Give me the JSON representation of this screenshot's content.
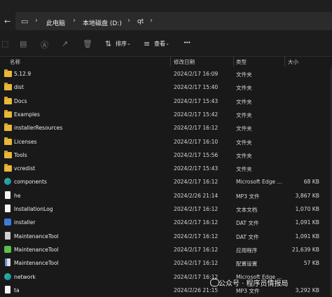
{
  "breadcrumbs": [
    "此电脑",
    "本地磁盘 (D:)",
    "qt"
  ],
  "toolbar": {
    "sort_label": "排序",
    "view_label": "查看",
    "more_label": "•••"
  },
  "columns": {
    "name": "名称",
    "modified": "修改日期",
    "type": "类型",
    "size": "大小"
  },
  "files": [
    {
      "name": "5.12.9",
      "date": "2024/2/17 16:09",
      "type": "文件夹",
      "size": "",
      "icon": "folder-icon"
    },
    {
      "name": "dist",
      "date": "2024/2/17 15:40",
      "type": "文件夹",
      "size": "",
      "icon": "folder-icon"
    },
    {
      "name": "Docs",
      "date": "2024/2/17 15:43",
      "type": "文件夹",
      "size": "",
      "icon": "folder-icon"
    },
    {
      "name": "Examples",
      "date": "2024/2/17 15:42",
      "type": "文件夹",
      "size": "",
      "icon": "folder-icon"
    },
    {
      "name": "installerResources",
      "date": "2024/2/17 16:12",
      "type": "文件夹",
      "size": "",
      "icon": "folder-icon"
    },
    {
      "name": "Licenses",
      "date": "2024/2/17 16:10",
      "type": "文件夹",
      "size": "",
      "icon": "folder-icon"
    },
    {
      "name": "Tools",
      "date": "2024/2/17 15:56",
      "type": "文件夹",
      "size": "",
      "icon": "folder-icon"
    },
    {
      "name": "vcredist",
      "date": "2024/2/17 15:43",
      "type": "文件夹",
      "size": "",
      "icon": "folder-icon"
    },
    {
      "name": "components",
      "date": "2024/2/17 16:12",
      "type": "Microsoft Edge ...",
      "size": "68 KB",
      "icon": "edge-icon"
    },
    {
      "name": "he",
      "date": "2024/2/26 21:14",
      "type": "MP3 文件",
      "size": "3,867 KB",
      "icon": "audio-file-icon"
    },
    {
      "name": "InstallationLog",
      "date": "2024/2/17 16:12",
      "type": "文本文档",
      "size": "1,070 KB",
      "icon": "text-file-icon"
    },
    {
      "name": "installer",
      "date": "2024/2/17 16:12",
      "type": "DAT 文件",
      "size": "1,091 KB",
      "icon": "dat-file-icon"
    },
    {
      "name": "MaintenanceTool",
      "date": "2024/2/17 16:12",
      "type": "DAT 文件",
      "size": "1,091 KB",
      "icon": "dat-file-icon"
    },
    {
      "name": "MaintenanceTool",
      "date": "2024/2/17 16:12",
      "type": "应用程序",
      "size": "21,639 KB",
      "icon": "application-icon"
    },
    {
      "name": "MaintenanceTool",
      "date": "2024/2/17 16:12",
      "type": "配置设置",
      "size": "57 KB",
      "icon": "config-file-icon"
    },
    {
      "name": "network",
      "date": "2024/2/17 16:12",
      "type": "Microsoft Edge ...",
      "size": "",
      "icon": "edge-icon"
    },
    {
      "name": "ta",
      "date": "2024/2/26 21:15",
      "type": "MP3 文件",
      "size": "3,292 KB",
      "icon": "audio-file-icon"
    }
  ],
  "watermark": "公众号 · 程序员情报局",
  "colors": {
    "background": "#191919",
    "folder": "#e8b73c",
    "text": "#e6e6e6"
  }
}
